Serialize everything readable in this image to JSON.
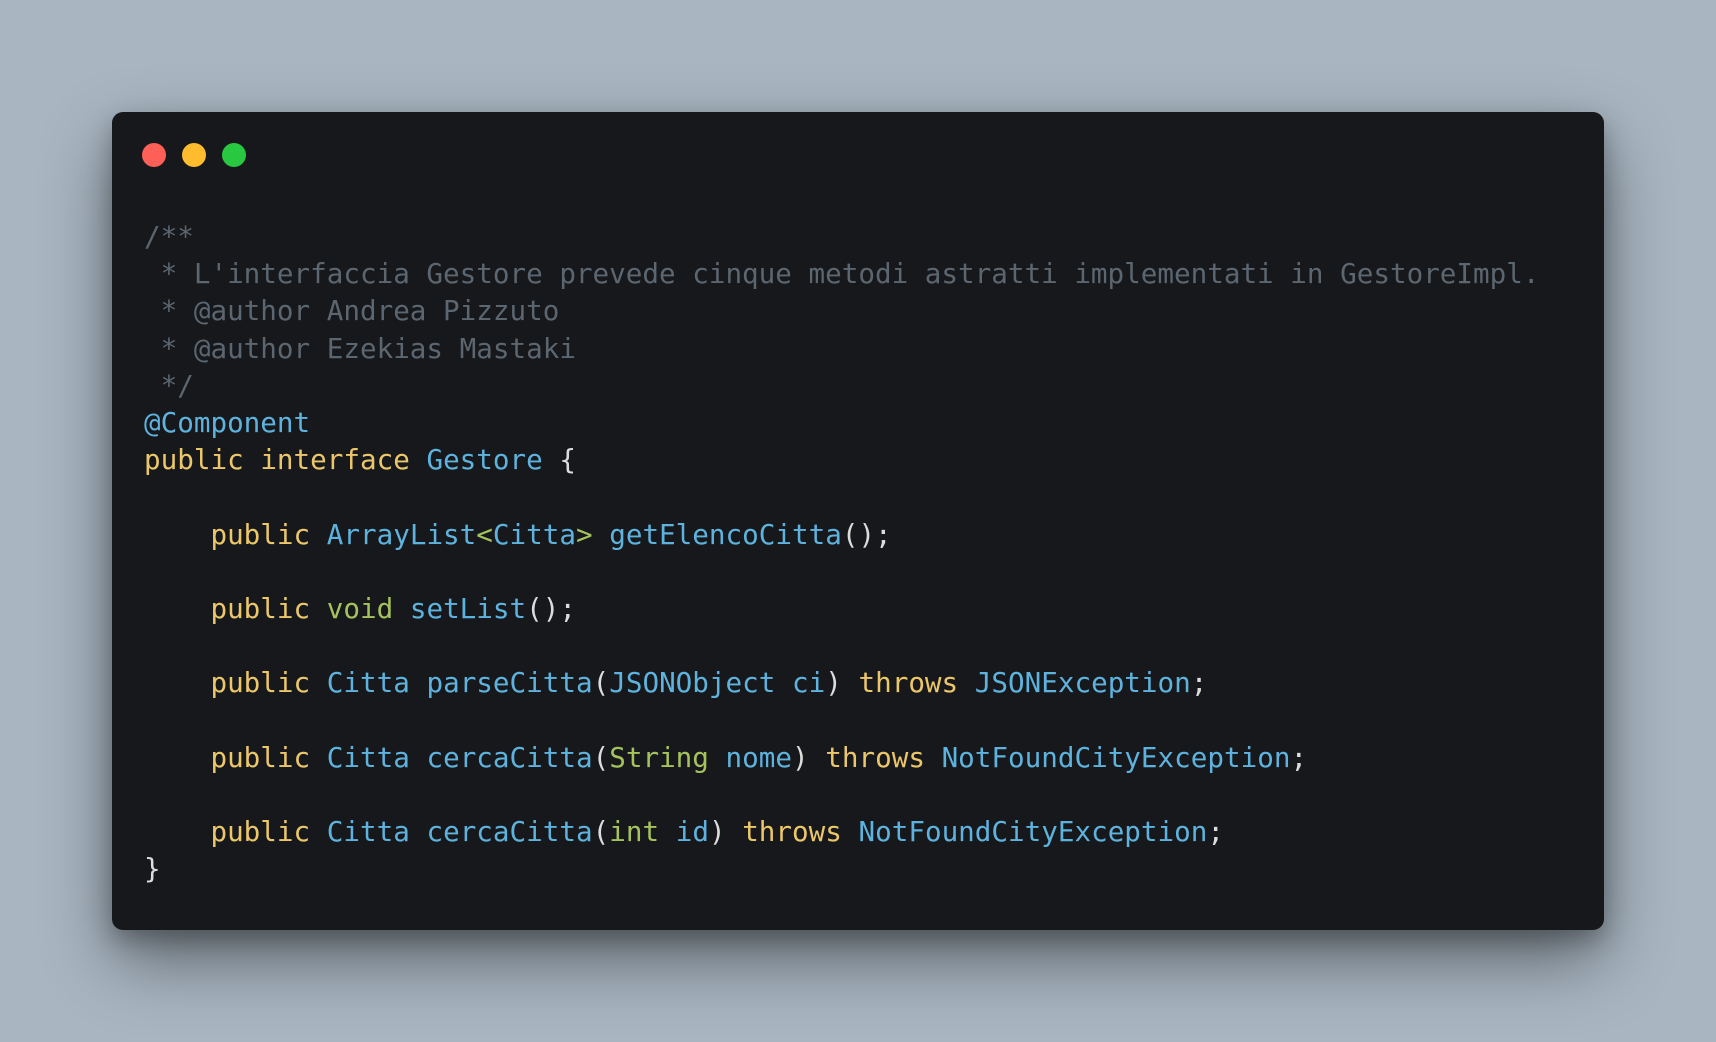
{
  "colors": {
    "page_background": "#a9b6c2",
    "window_background": "#16181b",
    "close_button": "#fe5f57",
    "minimize_button": "#febc2e",
    "maximize_button": "#28c840",
    "comment": "#5c6670",
    "keyword": "#ecc76a",
    "type": "#5eb3de",
    "primitive": "#a5c25c",
    "punctuation": "#dcdcdc"
  },
  "window": {
    "buttons": [
      "close",
      "minimize",
      "maximize"
    ]
  },
  "code": {
    "language": "java",
    "lines": [
      [
        {
          "t": "comment",
          "v": "/**"
        }
      ],
      [
        {
          "t": "comment",
          "v": " * L'interfaccia Gestore prevede cinque metodi astratti implementati in GestoreImpl."
        }
      ],
      [
        {
          "t": "comment",
          "v": " * @author Andrea Pizzuto"
        }
      ],
      [
        {
          "t": "comment",
          "v": " * @author Ezekias Mastaki"
        }
      ],
      [
        {
          "t": "comment",
          "v": " */"
        }
      ],
      [
        {
          "t": "annotation",
          "v": "@Component"
        }
      ],
      [
        {
          "t": "keyword",
          "v": "public"
        },
        {
          "t": "plain",
          "v": " "
        },
        {
          "t": "keyword",
          "v": "interface"
        },
        {
          "t": "plain",
          "v": " "
        },
        {
          "t": "type",
          "v": "Gestore"
        },
        {
          "t": "plain",
          "v": " "
        },
        {
          "t": "punct",
          "v": "{"
        }
      ],
      [],
      [
        {
          "t": "plain",
          "v": "    "
        },
        {
          "t": "keyword",
          "v": "public"
        },
        {
          "t": "plain",
          "v": " "
        },
        {
          "t": "type",
          "v": "ArrayList"
        },
        {
          "t": "primitive",
          "v": "<"
        },
        {
          "t": "type",
          "v": "Citta"
        },
        {
          "t": "primitive",
          "v": ">"
        },
        {
          "t": "plain",
          "v": " "
        },
        {
          "t": "method",
          "v": "getElencoCitta"
        },
        {
          "t": "punct",
          "v": "();"
        }
      ],
      [],
      [
        {
          "t": "plain",
          "v": "    "
        },
        {
          "t": "keyword",
          "v": "public"
        },
        {
          "t": "plain",
          "v": " "
        },
        {
          "t": "primitive",
          "v": "void"
        },
        {
          "t": "plain",
          "v": " "
        },
        {
          "t": "method",
          "v": "setList"
        },
        {
          "t": "punct",
          "v": "();"
        }
      ],
      [],
      [
        {
          "t": "plain",
          "v": "    "
        },
        {
          "t": "keyword",
          "v": "public"
        },
        {
          "t": "plain",
          "v": " "
        },
        {
          "t": "type",
          "v": "Citta"
        },
        {
          "t": "plain",
          "v": " "
        },
        {
          "t": "method",
          "v": "parseCitta"
        },
        {
          "t": "punct",
          "v": "("
        },
        {
          "t": "type",
          "v": "JSONObject"
        },
        {
          "t": "plain",
          "v": " "
        },
        {
          "t": "param",
          "v": "ci"
        },
        {
          "t": "punct",
          "v": ")"
        },
        {
          "t": "plain",
          "v": " "
        },
        {
          "t": "keyword",
          "v": "throws"
        },
        {
          "t": "plain",
          "v": " "
        },
        {
          "t": "type",
          "v": "JSONException"
        },
        {
          "t": "punct",
          "v": ";"
        }
      ],
      [],
      [
        {
          "t": "plain",
          "v": "    "
        },
        {
          "t": "keyword",
          "v": "public"
        },
        {
          "t": "plain",
          "v": " "
        },
        {
          "t": "type",
          "v": "Citta"
        },
        {
          "t": "plain",
          "v": " "
        },
        {
          "t": "method",
          "v": "cercaCitta"
        },
        {
          "t": "punct",
          "v": "("
        },
        {
          "t": "primitive",
          "v": "String"
        },
        {
          "t": "plain",
          "v": " "
        },
        {
          "t": "param",
          "v": "nome"
        },
        {
          "t": "punct",
          "v": ")"
        },
        {
          "t": "plain",
          "v": " "
        },
        {
          "t": "keyword",
          "v": "throws"
        },
        {
          "t": "plain",
          "v": " "
        },
        {
          "t": "type",
          "v": "NotFoundCityException"
        },
        {
          "t": "punct",
          "v": ";"
        }
      ],
      [],
      [
        {
          "t": "plain",
          "v": "    "
        },
        {
          "t": "keyword",
          "v": "public"
        },
        {
          "t": "plain",
          "v": " "
        },
        {
          "t": "type",
          "v": "Citta"
        },
        {
          "t": "plain",
          "v": " "
        },
        {
          "t": "method",
          "v": "cercaCitta"
        },
        {
          "t": "punct",
          "v": "("
        },
        {
          "t": "primitive",
          "v": "int"
        },
        {
          "t": "plain",
          "v": " "
        },
        {
          "t": "param",
          "v": "id"
        },
        {
          "t": "punct",
          "v": ")"
        },
        {
          "t": "plain",
          "v": " "
        },
        {
          "t": "keyword",
          "v": "throws"
        },
        {
          "t": "plain",
          "v": " "
        },
        {
          "t": "type",
          "v": "NotFoundCityException"
        },
        {
          "t": "punct",
          "v": ";"
        }
      ],
      [
        {
          "t": "punct",
          "v": "}"
        }
      ]
    ]
  }
}
